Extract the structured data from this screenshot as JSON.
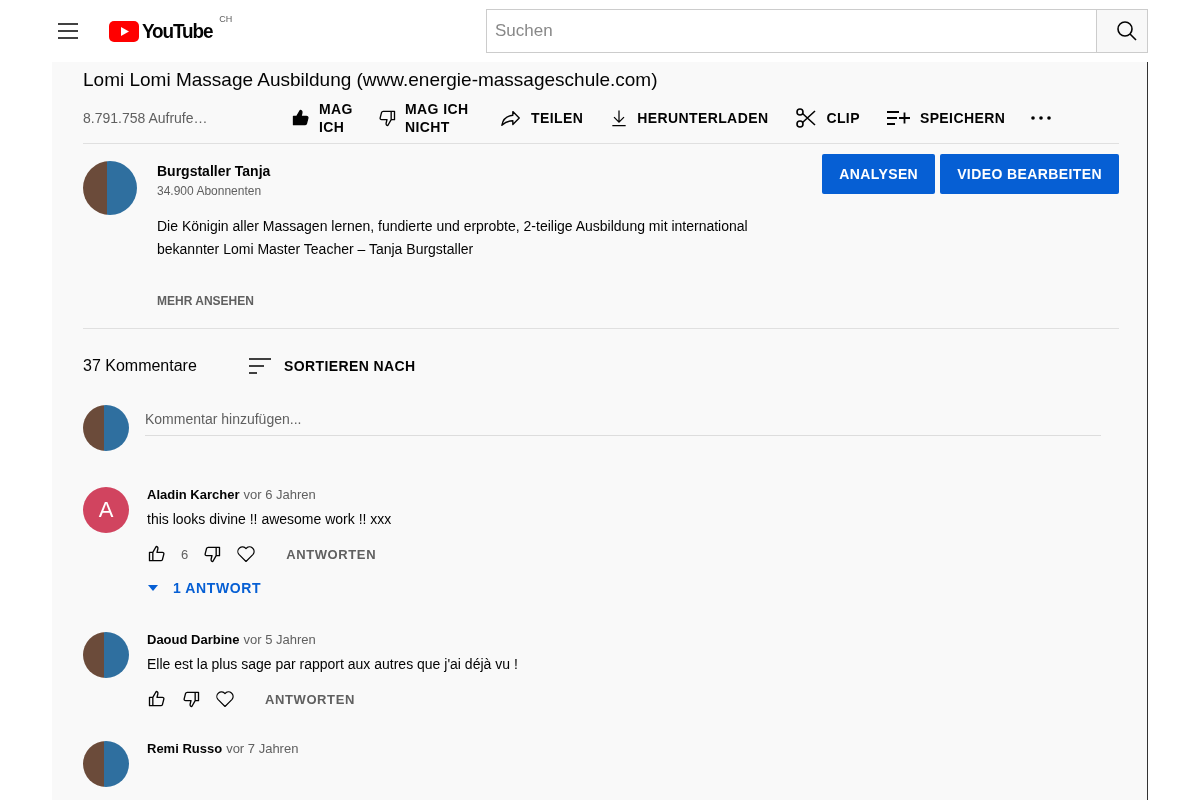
{
  "header": {
    "logo_text": "YouTube",
    "country": "CH",
    "search": {
      "placeholder": "Suchen"
    }
  },
  "video": {
    "title": "Lomi Lomi Massage Ausbildung (www.energie-massageschule.com)",
    "views": "8.791.758 Aufrufe…",
    "like": {
      "label": "MAG ICH",
      "selected": true
    },
    "dislike": {
      "label": "MAG ICH NICHT",
      "selected": false
    },
    "actions": [
      {
        "kind": "share",
        "label": "TEILEN"
      },
      {
        "kind": "download",
        "label": "HERUNTERLADEN"
      },
      {
        "kind": "clip",
        "label": "CLIP"
      },
      {
        "kind": "save",
        "label": "SPEICHERN"
      },
      {
        "kind": "more"
      }
    ]
  },
  "channel": {
    "name": "Burgstaller Tanja",
    "subscribers": "34.900 Abonnenten",
    "buttons": [
      "ANALYSEN",
      "VIDEO BEARBEITEN"
    ],
    "description": [
      "Die Königin aller Massagen lernen, fundierte und erprobte, 2-teilige Ausbildung mit international",
      "bekannter Lomi Master Teacher – Tanja Burgstaller"
    ],
    "more": "MEHR ANSEHEN"
  },
  "comments_header": {
    "count": "37 Kommentare",
    "sort": "SORTIEREN NACH"
  },
  "comment_input": {
    "placeholder": "Kommentar hinzufügen..."
  },
  "comments": [
    {
      "avatar": {
        "kind": "letter",
        "letter": "A",
        "color": "#d1445f"
      },
      "author": "Aladin Karcher",
      "time": "vor 6 Jahren",
      "text": "this looks divine !! awesome work !! xxx",
      "likes": "6",
      "reply": "ANTWORTEN",
      "replies": {
        "label": "1 ANTWORT",
        "expanded": false
      }
    },
    {
      "avatar": {
        "kind": "photo"
      },
      "author": "Daoud Darbine",
      "time": "vor 5 Jahren",
      "text": "Elle est la plus sage par rapport aux autres que j'ai déjà vu !",
      "reply": "ANTWORTEN"
    },
    {
      "avatar": {
        "kind": "photo"
      },
      "author": "Remi Russo",
      "time": "vor 7 Jahren"
    }
  ]
}
